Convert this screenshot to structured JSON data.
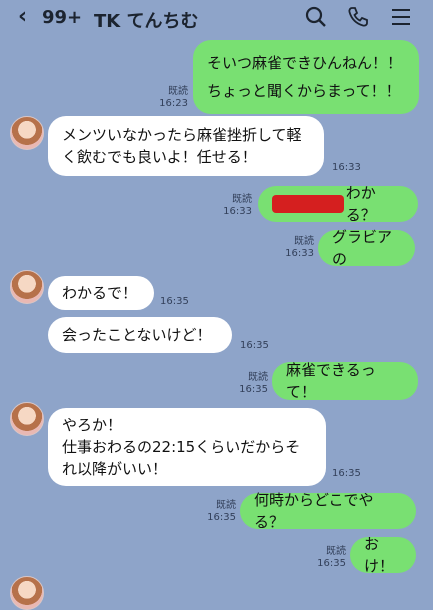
{
  "header": {
    "back_icon": "chevron-left-icon",
    "unread_count": "99+",
    "title": "TK てんちむ",
    "icons": [
      "search-icon",
      "phone-icon",
      "menu-icon"
    ]
  },
  "messages": [
    {
      "side": "out",
      "lines": [
        "そいつ麻雀できひんねん！！",
        "",
        "ちょっと聞くからまって！！"
      ],
      "read": "既読",
      "time": "16:23"
    },
    {
      "side": "in",
      "lines": [
        "メンツいなかったら麻雀挫折して軽",
        "く飲むでも良いよ！任せる！"
      ],
      "time": "16:33"
    },
    {
      "side": "out",
      "lines": [
        "わかる？"
      ],
      "redacted": true,
      "read": "既読",
      "time": "16:33"
    },
    {
      "side": "out",
      "lines": [
        "グラビアの"
      ],
      "read": "既読",
      "time": "16:33"
    },
    {
      "side": "in",
      "lines": [
        "わかるで！"
      ],
      "time": "16:35"
    },
    {
      "side": "in",
      "lines": [
        "会ったことないけど！"
      ],
      "time": "16:35"
    },
    {
      "side": "out",
      "lines": [
        "麻雀できるって！"
      ],
      "read": "既読",
      "time": "16:35"
    },
    {
      "side": "in",
      "lines": [
        "やろか！",
        "仕事おわるの22:15くらいだからそ",
        "れ以降がいい！"
      ],
      "time": "16:35"
    },
    {
      "side": "out",
      "lines": [
        "何時からどこでやる？"
      ],
      "read": "既読",
      "time": "16:35"
    },
    {
      "side": "out",
      "lines": [
        "おけ！"
      ],
      "read": "既読",
      "time": "16:35"
    }
  ],
  "colors": {
    "background": "#8ea4c9",
    "outgoing": "#79e072",
    "incoming": "#ffffff"
  }
}
